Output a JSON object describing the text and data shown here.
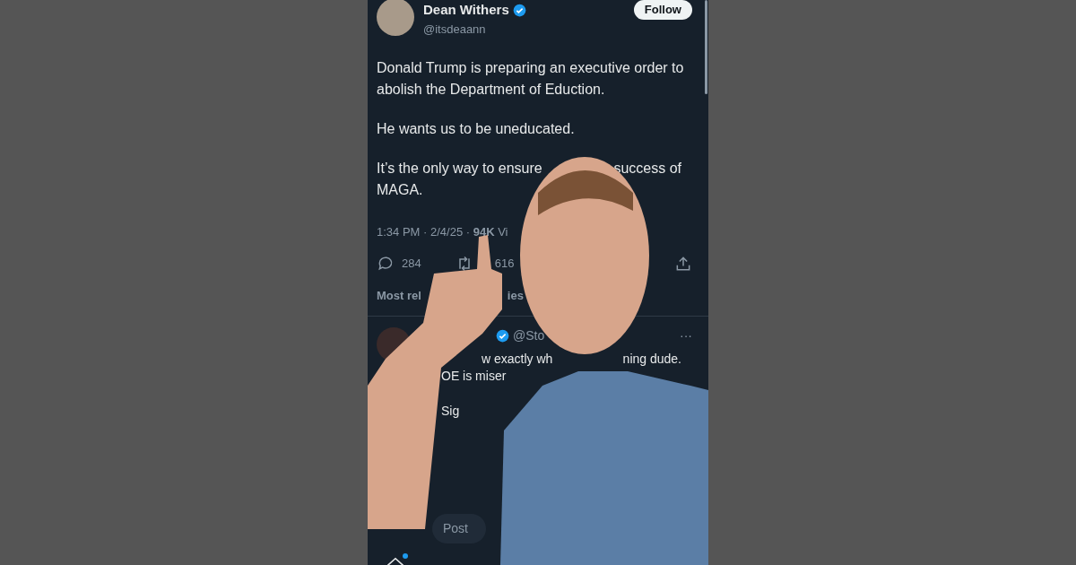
{
  "tweet": {
    "author": {
      "name": "Dean Withers",
      "handle": "@itsdeaann",
      "verified": true
    },
    "follow_button": "Follow",
    "paragraphs": [
      [
        [
          "Donald Trump is preparing an executive order to"
        ],
        [
          "abolish the Department of Eduction."
        ]
      ],
      [
        [
          "He wants us to be uneducated."
        ]
      ],
      [
        [
          "It’s the only way to ensure",
          "success of"
        ],
        [
          "MAGA."
        ]
      ]
    ],
    "meta": "1:34 PM · 2/4/25 · **94K** Vi",
    "reply_count": "284",
    "repost_count": "616",
    "sort_label": [
      "Most rel",
      "ies"
    ]
  },
  "reply": {
    "handle": "@Sto",
    "verified": true,
    "menu": "···",
    "lines": [
      [
        "w exactly wh",
        "ning dude."
      ],
      [
        "OE is miser"
      ]
    ],
    "extra": "Sig"
  },
  "composer": {
    "placeholder": "Post"
  },
  "nav": {
    "home_has_update": true
  }
}
